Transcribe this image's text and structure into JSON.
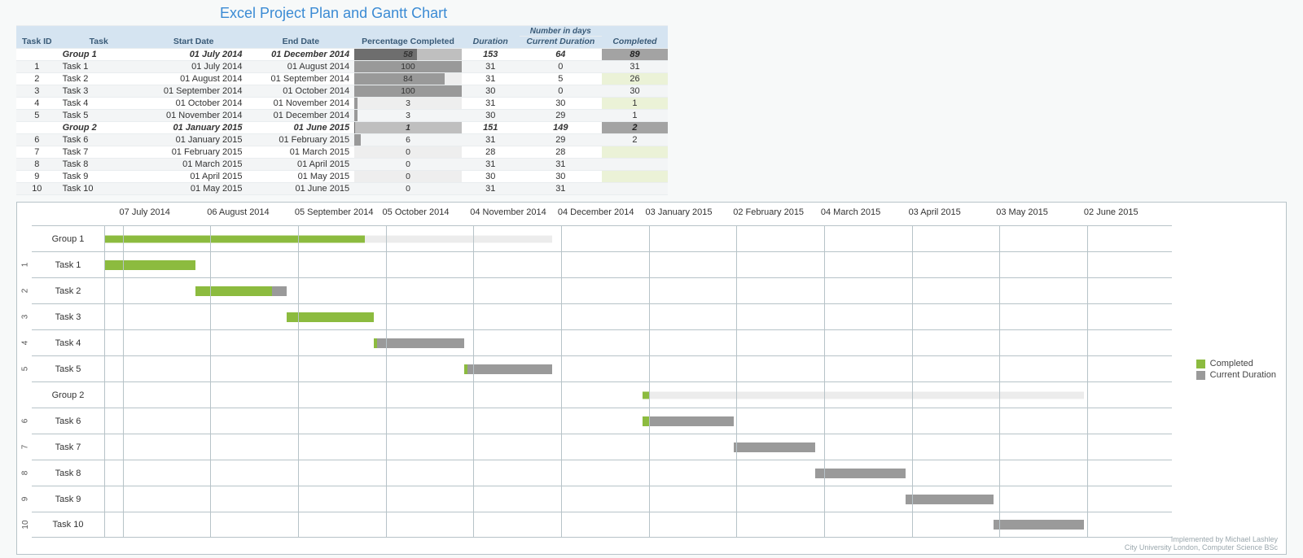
{
  "title": "Excel Project Plan and Gantt Chart",
  "table": {
    "headers": {
      "id": "Task ID",
      "task": "Task",
      "start": "Start Date",
      "end": "End Date",
      "pct": "Percentage Completed",
      "dur": "Duration",
      "cur_super": "Number in days",
      "cur": "Current Duration",
      "comp": "Completed"
    },
    "rows": [
      {
        "id": "",
        "task": "Group 1",
        "start": "01 July 2014",
        "end": "01 December 2014",
        "pct": "58",
        "dur": "153",
        "cur": "64",
        "comp": "89",
        "group": true
      },
      {
        "id": "1",
        "task": "Task 1",
        "start": "01 July 2014",
        "end": "01 August 2014",
        "pct": "100",
        "dur": "31",
        "cur": "0",
        "comp": "31"
      },
      {
        "id": "2",
        "task": "Task 2",
        "start": "01 August 2014",
        "end": "01 September 2014",
        "pct": "84",
        "dur": "31",
        "cur": "5",
        "comp": "26"
      },
      {
        "id": "3",
        "task": "Task 3",
        "start": "01 September 2014",
        "end": "01 October 2014",
        "pct": "100",
        "dur": "30",
        "cur": "0",
        "comp": "30"
      },
      {
        "id": "4",
        "task": "Task 4",
        "start": "01 October 2014",
        "end": "01 November 2014",
        "pct": "3",
        "dur": "31",
        "cur": "30",
        "comp": "1"
      },
      {
        "id": "5",
        "task": "Task 5",
        "start": "01 November 2014",
        "end": "01 December 2014",
        "pct": "3",
        "dur": "30",
        "cur": "29",
        "comp": "1"
      },
      {
        "id": "",
        "task": "Group 2",
        "start": "01 January 2015",
        "end": "01 June 2015",
        "pct": "1",
        "dur": "151",
        "cur": "149",
        "comp": "2",
        "group": true
      },
      {
        "id": "6",
        "task": "Task 6",
        "start": "01 January 2015",
        "end": "01 February 2015",
        "pct": "6",
        "dur": "31",
        "cur": "29",
        "comp": "2"
      },
      {
        "id": "7",
        "task": "Task 7",
        "start": "01 February 2015",
        "end": "01 March 2015",
        "pct": "0",
        "dur": "28",
        "cur": "28",
        "comp": ""
      },
      {
        "id": "8",
        "task": "Task 8",
        "start": "01 March 2015",
        "end": "01 April 2015",
        "pct": "0",
        "dur": "31",
        "cur": "31",
        "comp": ""
      },
      {
        "id": "9",
        "task": "Task 9",
        "start": "01 April 2015",
        "end": "01 May 2015",
        "pct": "0",
        "dur": "30",
        "cur": "30",
        "comp": ""
      },
      {
        "id": "10",
        "task": "Task 10",
        "start": "01 May 2015",
        "end": "01 June 2015",
        "pct": "0",
        "dur": "31",
        "cur": "31",
        "comp": ""
      }
    ]
  },
  "legend": {
    "completed": "Completed",
    "current": "Current Duration"
  },
  "credit": {
    "line1": "Implemented by Michael Lashley",
    "line2": "City University London, Computer Science BSc"
  },
  "chart_data": {
    "type": "bar",
    "title": "Excel Project Plan and Gantt Chart",
    "orientation": "horizontal",
    "xlim": [
      "01 July 2014",
      "30 June 2015"
    ],
    "ticks": [
      "07 July 2014",
      "06 August 2014",
      "05 September 2014",
      "05 October 2014",
      "04 November 2014",
      "04 December 2014",
      "03 January 2015",
      "02 February 2015",
      "04 March 2015",
      "03 April 2015",
      "03 May 2015",
      "02 June 2015"
    ],
    "tick_dayindex": [
      6,
      36,
      66,
      96,
      126,
      156,
      186,
      216,
      246,
      276,
      306,
      336
    ],
    "total_days": 365,
    "series_legend": [
      "Completed",
      "Current Duration"
    ],
    "rows": [
      {
        "num": "",
        "label": "Group 1",
        "start_day": 0,
        "total": 153,
        "completed": 89,
        "current": 64,
        "group": true
      },
      {
        "num": "1",
        "label": "Task 1",
        "start_day": 0,
        "total": 31,
        "completed": 31,
        "current": 0
      },
      {
        "num": "2",
        "label": "Task 2",
        "start_day": 31,
        "total": 31,
        "completed": 26,
        "current": 5
      },
      {
        "num": "3",
        "label": "Task 3",
        "start_day": 62,
        "total": 30,
        "completed": 30,
        "current": 0
      },
      {
        "num": "4",
        "label": "Task 4",
        "start_day": 92,
        "total": 31,
        "completed": 1,
        "current": 30
      },
      {
        "num": "5",
        "label": "Task 5",
        "start_day": 123,
        "total": 30,
        "completed": 1,
        "current": 29
      },
      {
        "num": "",
        "label": "Group 2",
        "start_day": 184,
        "total": 151,
        "completed": 2,
        "current": 149,
        "group": true
      },
      {
        "num": "6",
        "label": "Task 6",
        "start_day": 184,
        "total": 31,
        "completed": 2,
        "current": 29
      },
      {
        "num": "7",
        "label": "Task 7",
        "start_day": 215,
        "total": 28,
        "completed": 0,
        "current": 28
      },
      {
        "num": "8",
        "label": "Task 8",
        "start_day": 243,
        "total": 31,
        "completed": 0,
        "current": 31
      },
      {
        "num": "9",
        "label": "Task 9",
        "start_day": 274,
        "total": 30,
        "completed": 0,
        "current": 30
      },
      {
        "num": "10",
        "label": "Task 10",
        "start_day": 304,
        "total": 31,
        "completed": 0,
        "current": 31
      }
    ]
  }
}
